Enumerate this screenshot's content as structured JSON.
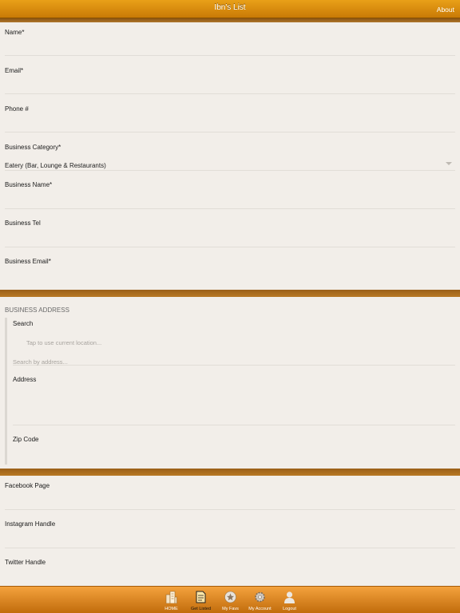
{
  "header": {
    "title": "Ibn's List",
    "about": "About"
  },
  "form": {
    "name": "Name*",
    "email": "Email*",
    "phone": "Phone #",
    "business_category_label": "Business Category*",
    "business_category_value": "Eatery (Bar, Lounge & Restaurants)",
    "business_name": "Business Name*",
    "business_tel": "Business Tel",
    "business_email": "Business Email*"
  },
  "address": {
    "section_title": "BUSINESS ADDRESS",
    "search_label": "Search",
    "current_location_placeholder": "Tap to use current location...",
    "search_placeholder": "Search by address...",
    "address_label": "Address",
    "zip_label": "Zip Code"
  },
  "social": {
    "facebook": "Facebook Page",
    "instagram": "Instagram Handle",
    "twitter": "Twitter Handle"
  },
  "tabs": [
    {
      "label": "HOME",
      "icon": "buildings-icon"
    },
    {
      "label": "Get Listed",
      "icon": "document-icon"
    },
    {
      "label": "My Favs",
      "icon": "star-icon"
    },
    {
      "label": "My Account",
      "icon": "gear-icon"
    },
    {
      "label": "Logout",
      "icon": "user-icon"
    }
  ]
}
